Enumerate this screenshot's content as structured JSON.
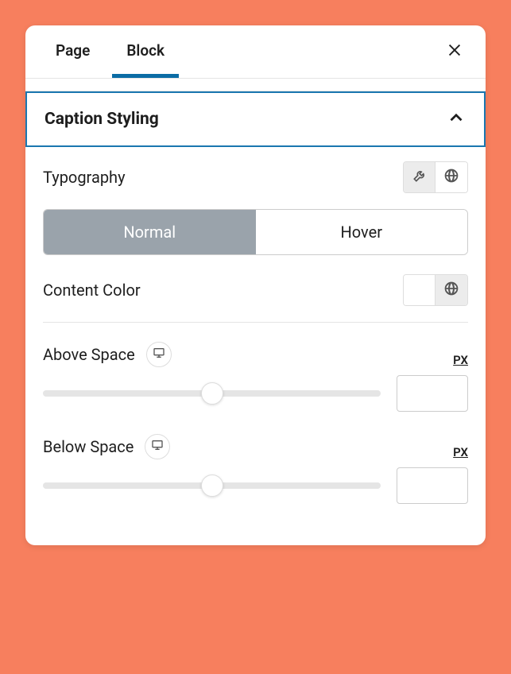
{
  "tabs": {
    "page": "Page",
    "block": "Block"
  },
  "section": {
    "title": "Caption Styling"
  },
  "typography": {
    "label": "Typography"
  },
  "state_toggle": {
    "normal": "Normal",
    "hover": "Hover"
  },
  "content_color": {
    "label": "Content Color"
  },
  "above_space": {
    "label": "Above Space",
    "unit": "PX",
    "value": ""
  },
  "below_space": {
    "label": "Below Space",
    "unit": "PX",
    "value": ""
  }
}
